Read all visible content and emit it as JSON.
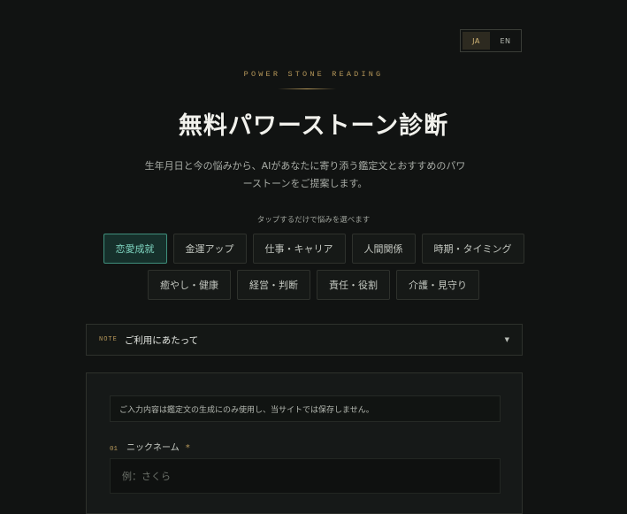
{
  "lang_switch": {
    "options": [
      "JA",
      "EN"
    ],
    "selected": "JA"
  },
  "hero": {
    "eyebrow": "POWER STONE READING",
    "title": "無料パワーストーン診断",
    "subtitle": "生年月日と今の悩みから、AIがあなたに寄り添う鑑定文とおすすめのパワーストーンをご提案します。"
  },
  "concerns": {
    "hint": "タップするだけで悩みを選べます",
    "items": [
      "恋愛成就",
      "金運アップ",
      "仕事・キャリア",
      "人間関係",
      "時期・タイミング",
      "癒やし・健康",
      "経営・判断",
      "責任・役割",
      "介護・見守り"
    ],
    "selected": "恋愛成就"
  },
  "note": {
    "tag": "NOTE",
    "title": "ご利用にあたって",
    "caret_icon": "caret-down"
  },
  "form": {
    "privacy_text": "ご入力内容は鑑定文の生成にのみ使用し、当サイトでは保存しません。",
    "fields": [
      {
        "number": "01",
        "label": "ニックネーム",
        "required_mark": "*",
        "value": "",
        "placeholder": "例：さくら"
      }
    ]
  },
  "colors": {
    "background": "#111312",
    "accent_gold": "#b7985a",
    "accent_teal": "#7fd5c0",
    "panel": "#161918"
  }
}
